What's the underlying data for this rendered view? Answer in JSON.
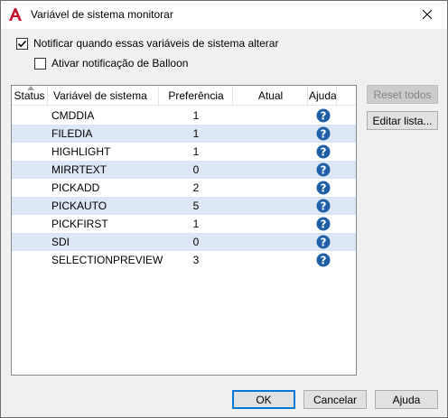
{
  "window": {
    "title": "Variável de sistema monitorar"
  },
  "options": {
    "notify_label": "Notificar quando essas variáveis de sistema alterar",
    "notify_checked": true,
    "balloon_label": "Ativar notificação de Balloon",
    "balloon_checked": false
  },
  "table": {
    "columns": {
      "status": "Status",
      "variable": "Variável de sistema",
      "preference": "Preferência",
      "current": "Atual",
      "help": "Ajuda"
    },
    "rows": [
      {
        "name": "CMDDIA",
        "preference": "1"
      },
      {
        "name": "FILEDIA",
        "preference": "1"
      },
      {
        "name": "HIGHLIGHT",
        "preference": "1"
      },
      {
        "name": "MIRRTEXT",
        "preference": "0"
      },
      {
        "name": "PICKADD",
        "preference": "2"
      },
      {
        "name": "PICKAUTO",
        "preference": "5"
      },
      {
        "name": "PICKFIRST",
        "preference": "1"
      },
      {
        "name": "SDI",
        "preference": "0"
      },
      {
        "name": "SELECTIONPREVIEW",
        "preference": "3"
      }
    ]
  },
  "side_buttons": {
    "reset": "Reset todos",
    "edit": "Editar lista..."
  },
  "footer": {
    "ok": "OK",
    "cancel": "Cancelar",
    "help": "Ajuda"
  },
  "colors": {
    "accent": "#0078d7",
    "row_alt": "#dce6f4",
    "help_icon": "#1f5fa8",
    "app_icon": "#c8102e"
  }
}
